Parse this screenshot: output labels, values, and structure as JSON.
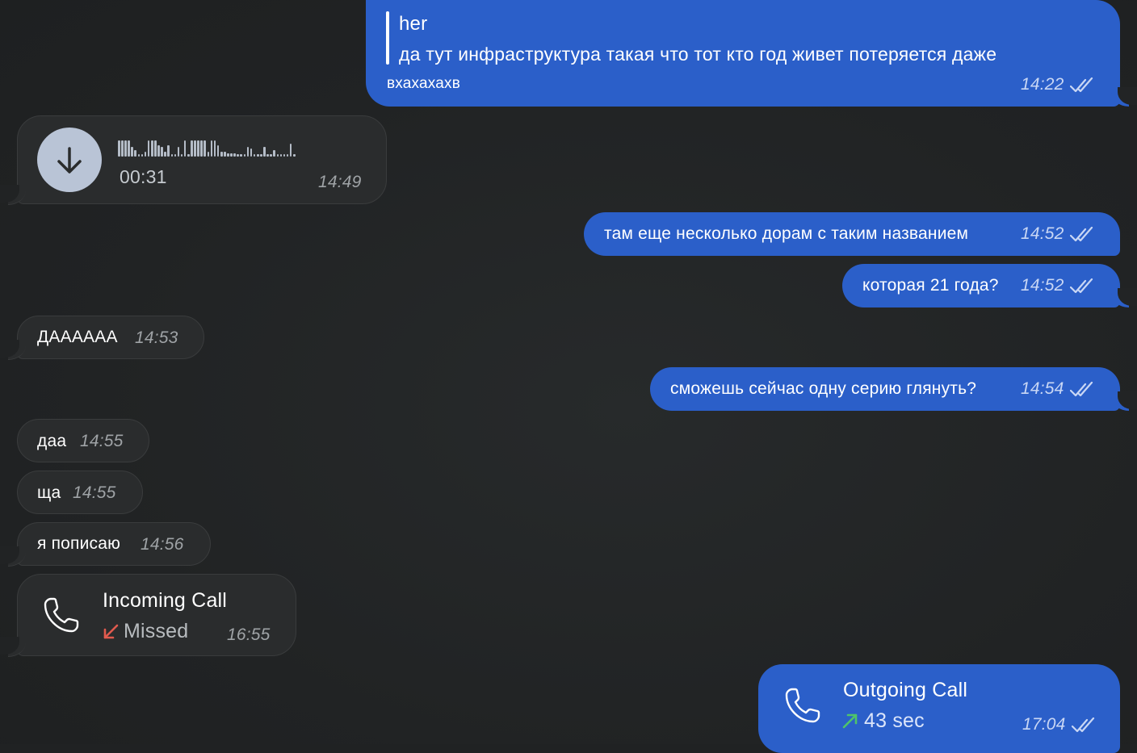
{
  "colors": {
    "background": "#212324",
    "outgoing_bubble": "#2b5fc9",
    "incoming_bubble": "#2a2c2d",
    "missed_arrow": "#e05a4e",
    "outgoing_arrow": "#4fc46a"
  },
  "messages": [
    {
      "id": "m1",
      "direction": "outgoing",
      "reply_author": "her",
      "reply_text": "да тут инфраструктура такая что тот кто год живет потеряется даже",
      "text": "вхахахахв",
      "time": "14:22",
      "status_icon": "double-check-icon"
    },
    {
      "id": "m2",
      "direction": "incoming",
      "type": "voice",
      "duration": "00:31",
      "time": "14:49",
      "icon": "download-arrow-icon"
    },
    {
      "id": "m3",
      "direction": "outgoing",
      "text": "там еще несколько дорам с таким названием",
      "time": "14:52",
      "status_icon": "double-check-icon"
    },
    {
      "id": "m4",
      "direction": "outgoing",
      "text": "которая 21 года?",
      "time": "14:52",
      "status_icon": "double-check-icon"
    },
    {
      "id": "m5",
      "direction": "incoming",
      "text": "ДАААААА",
      "time": "14:53"
    },
    {
      "id": "m6",
      "direction": "outgoing",
      "text": "сможешь сейчас одну серию глянуть?",
      "time": "14:54",
      "status_icon": "double-check-icon"
    },
    {
      "id": "m7",
      "direction": "incoming",
      "text": "даа",
      "time": "14:55"
    },
    {
      "id": "m8",
      "direction": "incoming",
      "text": "ща",
      "time": "14:55"
    },
    {
      "id": "m9",
      "direction": "incoming",
      "text": "я пописаю",
      "time": "14:56"
    },
    {
      "id": "m10",
      "direction": "incoming",
      "type": "call",
      "title": "Incoming Call",
      "status": "Missed",
      "time": "16:55",
      "icon": "phone-icon"
    },
    {
      "id": "m11",
      "direction": "outgoing",
      "type": "call",
      "title": "Outgoing Call",
      "status": "43 sec",
      "time": "17:04",
      "icon": "phone-icon",
      "status_icon": "double-check-icon"
    }
  ]
}
